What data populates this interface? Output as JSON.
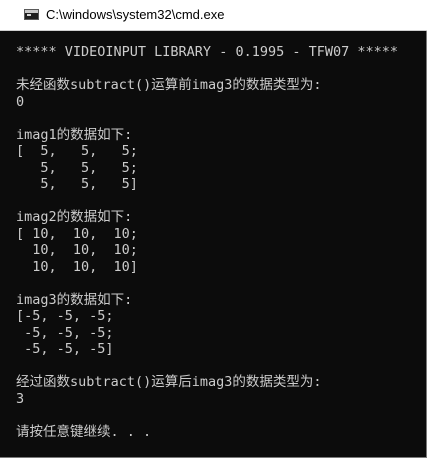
{
  "window": {
    "title": "C:\\windows\\system32\\cmd.exe",
    "icon": "console-icon"
  },
  "console": {
    "lines": [
      "***** VIDEOINPUT LIBRARY - 0.1995 - TFW07 *****",
      "",
      "未经函数subtract()运算前imag3的数据类型为:",
      "0",
      "",
      "imag1的数据如下:",
      "[  5,   5,   5;",
      "   5,   5,   5;",
      "   5,   5,   5]",
      "",
      "imag2的数据如下:",
      "[ 10,  10,  10;",
      "  10,  10,  10;",
      "  10,  10,  10]",
      "",
      "imag3的数据如下:",
      "[-5, -5, -5;",
      " -5, -5, -5;",
      " -5, -5, -5]",
      "",
      "经过函数subtract()运算后imag3的数据类型为:",
      "3",
      "",
      "请按任意键继续. . ."
    ]
  }
}
